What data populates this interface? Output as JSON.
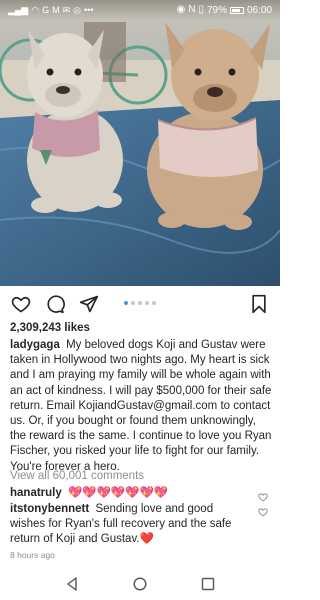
{
  "status_bar": {
    "left_icons": [
      "signal-icon",
      "wifi-icon",
      "gmail-icon",
      "g-icon",
      "mail-icon",
      "camera-icon",
      "instagram-icon"
    ],
    "right_icons": [
      "eye-comfort-icon",
      "nfc-icon",
      "mute-icon"
    ],
    "battery_percent": "79%",
    "time": "06:00"
  },
  "post": {
    "image_alt": "two-french-bulldogs-photo",
    "carousel": {
      "count": 5,
      "active_index": 0
    },
    "likes": "2,309,243 likes",
    "caption_user": "ladygaga",
    "caption_text": "My beloved dogs Koji and Gustav were taken in Hollywood two nights ago. My heart is sick and I am praying my family will be whole again with an act of kindness. I will pay $500,000 for their safe return. Email KojiandGustav@gmail.com to contact us. Or, if you bought or found them unknowingly, the reward is the same. I continue to love you Ryan Fischer, you risked your life to fight for our family. You're forever a hero.",
    "view_comments": "View all 60,001 comments",
    "comments": [
      {
        "user": "hanatruly",
        "text": "💖💖💖💖💖💖💖"
      },
      {
        "user": "itstonybennett",
        "text": "Sending love and good wishes for Ryan's full recovery and the safe return of Koji and Gustav.❤️"
      }
    ],
    "timestamp": "8 hours ago"
  },
  "colors": {
    "accent": "#3897f0",
    "text": "#262626",
    "muted": "#8e8e8e",
    "heart_red": "#e0245e"
  }
}
